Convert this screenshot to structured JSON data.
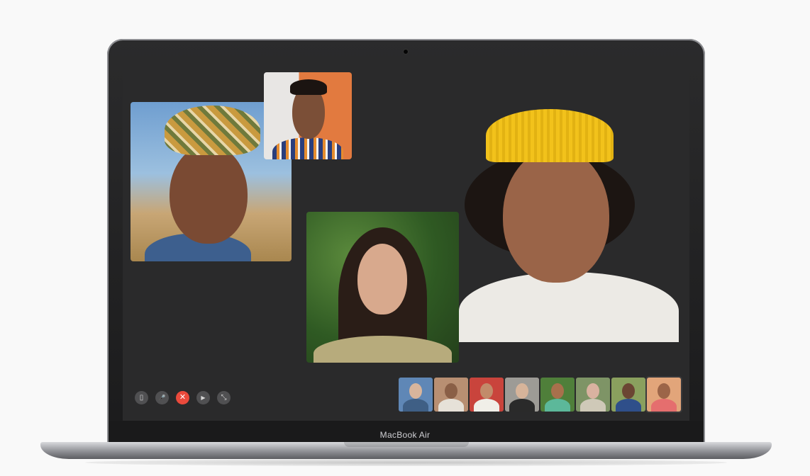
{
  "device": {
    "label": "MacBook Air"
  },
  "controls": [
    {
      "name": "sidebar",
      "glyph": "▯"
    },
    {
      "name": "mute",
      "glyph": "🎤"
    },
    {
      "name": "end-call",
      "glyph": "✕"
    },
    {
      "name": "camera",
      "glyph": "▶"
    },
    {
      "name": "fullscreen",
      "glyph": "⤡"
    }
  ],
  "participants_strip": [
    {
      "bg": "#5f87b6",
      "skin": "#d8b59c",
      "shirt": "#3f5f85"
    },
    {
      "bg": "#b88f72",
      "skin": "#8a5f46",
      "shirt": "#e6e1d8"
    },
    {
      "bg": "#c9443c",
      "skin": "#c28b6a",
      "shirt": "#f0efe8"
    },
    {
      "bg": "#9d9b96",
      "skin": "#d7b49a",
      "shirt": "#2a2a2a"
    },
    {
      "bg": "#4f7f3a",
      "skin": "#a8704c",
      "shirt": "#5cb89a"
    },
    {
      "bg": "#7e9466",
      "skin": "#d9b2a0",
      "shirt": "#cfc9b8"
    },
    {
      "bg": "#8aa05e",
      "skin": "#6b4533",
      "shirt": "#2f4f8a"
    },
    {
      "bg": "#e2a57a",
      "skin": "#9c6548",
      "shirt": "#e56e6e"
    }
  ]
}
